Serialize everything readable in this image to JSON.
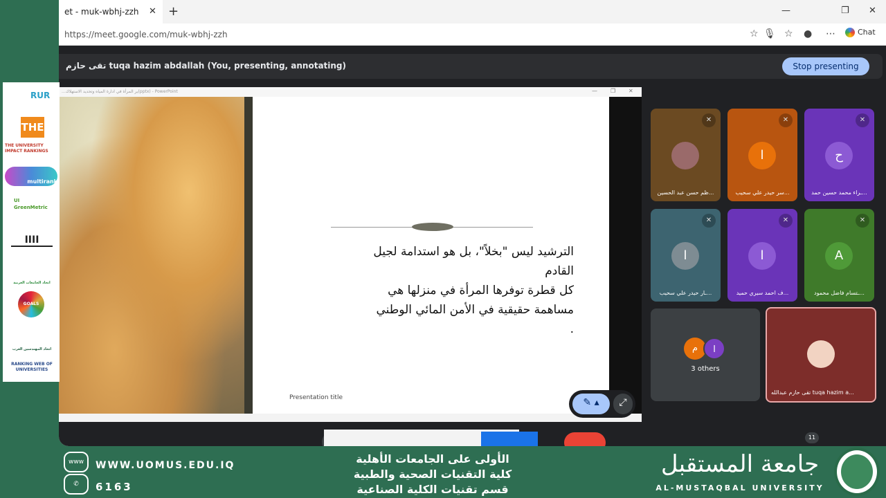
{
  "browser": {
    "tab_title": "et - muk-wbhj-zzh",
    "tab_close": "✕",
    "new_tab": "+",
    "url": "https://meet.google.com/muk-wbhj-zzh",
    "chat_label": "Chat",
    "window_controls": [
      "—",
      "❐",
      "✕"
    ]
  },
  "meet": {
    "presenter_line": "تقى حازم tuqa hazim abdallah (You, presenting, annotating)",
    "stop_button": "Stop presenting",
    "slide": {
      "window_title": "...ير المرأة في ادارة المياه وتحديد الاستهلاك(pptx) - PowerPoint",
      "text_lines": [
        "الترشيد ليس \"بخلاً\"، بل هو استدامة لجيل القادم",
        "كل قطرة توفرها المرأة في منزلها هي مساهمة حقيقية في الأمن المائي الوطني",
        "."
      ],
      "footer": "Presentation title"
    },
    "tiles": [
      {
        "name": "...ظم حسن عبد الحسين",
        "initial": "",
        "color": "#6b4a22"
      },
      {
        "name": "...سر حيدر علي سحيب",
        "initial": "ا",
        "color": "#b85510"
      },
      {
        "name": "...ـراء محمد حسين حمد",
        "initial": "ح",
        "color": "#6a34b8"
      },
      {
        "name": "...ـار حيدر علي سحيب",
        "initial": "ا",
        "color": "#3d6470"
      },
      {
        "name": "...ف احمد سيري حميد",
        "initial": "ا",
        "color": "#6a34b8"
      },
      {
        "name": "...ـتسام فاضل محمود",
        "initial": "A",
        "color": "#3f7a2a"
      }
    ],
    "others": {
      "label": "3 others",
      "avatars": [
        "م",
        "ا"
      ]
    },
    "self_tile": {
      "name": "تقى حازم عبدالله tuqa hazim a..."
    },
    "participant_count": "11"
  },
  "logos": [
    "RUR",
    "THE",
    "THE UNIVERSITY IMPACT RANKINGS",
    "multirank",
    "UI GreenMetric",
    "IIII",
    "اتحاد الجامعات العربية",
    "GOALS",
    "اتحاد المهندسين العرب",
    "RANKING WEB OF UNIVERSITIES"
  ],
  "footer": {
    "website": "WWW.UOMUS.EDU.IQ",
    "www_icon": "www",
    "phone": "6163",
    "arabic_lines": [
      "الأولى على الجامعات الأهلية",
      "كلية التقنيات الصحية والطبية",
      "قسم تقنيات الكلية الصناعية"
    ],
    "logo_ar": "جامعة المستقبل",
    "logo_en": "AL-MUSTAQBAL UNIVERSITY"
  }
}
